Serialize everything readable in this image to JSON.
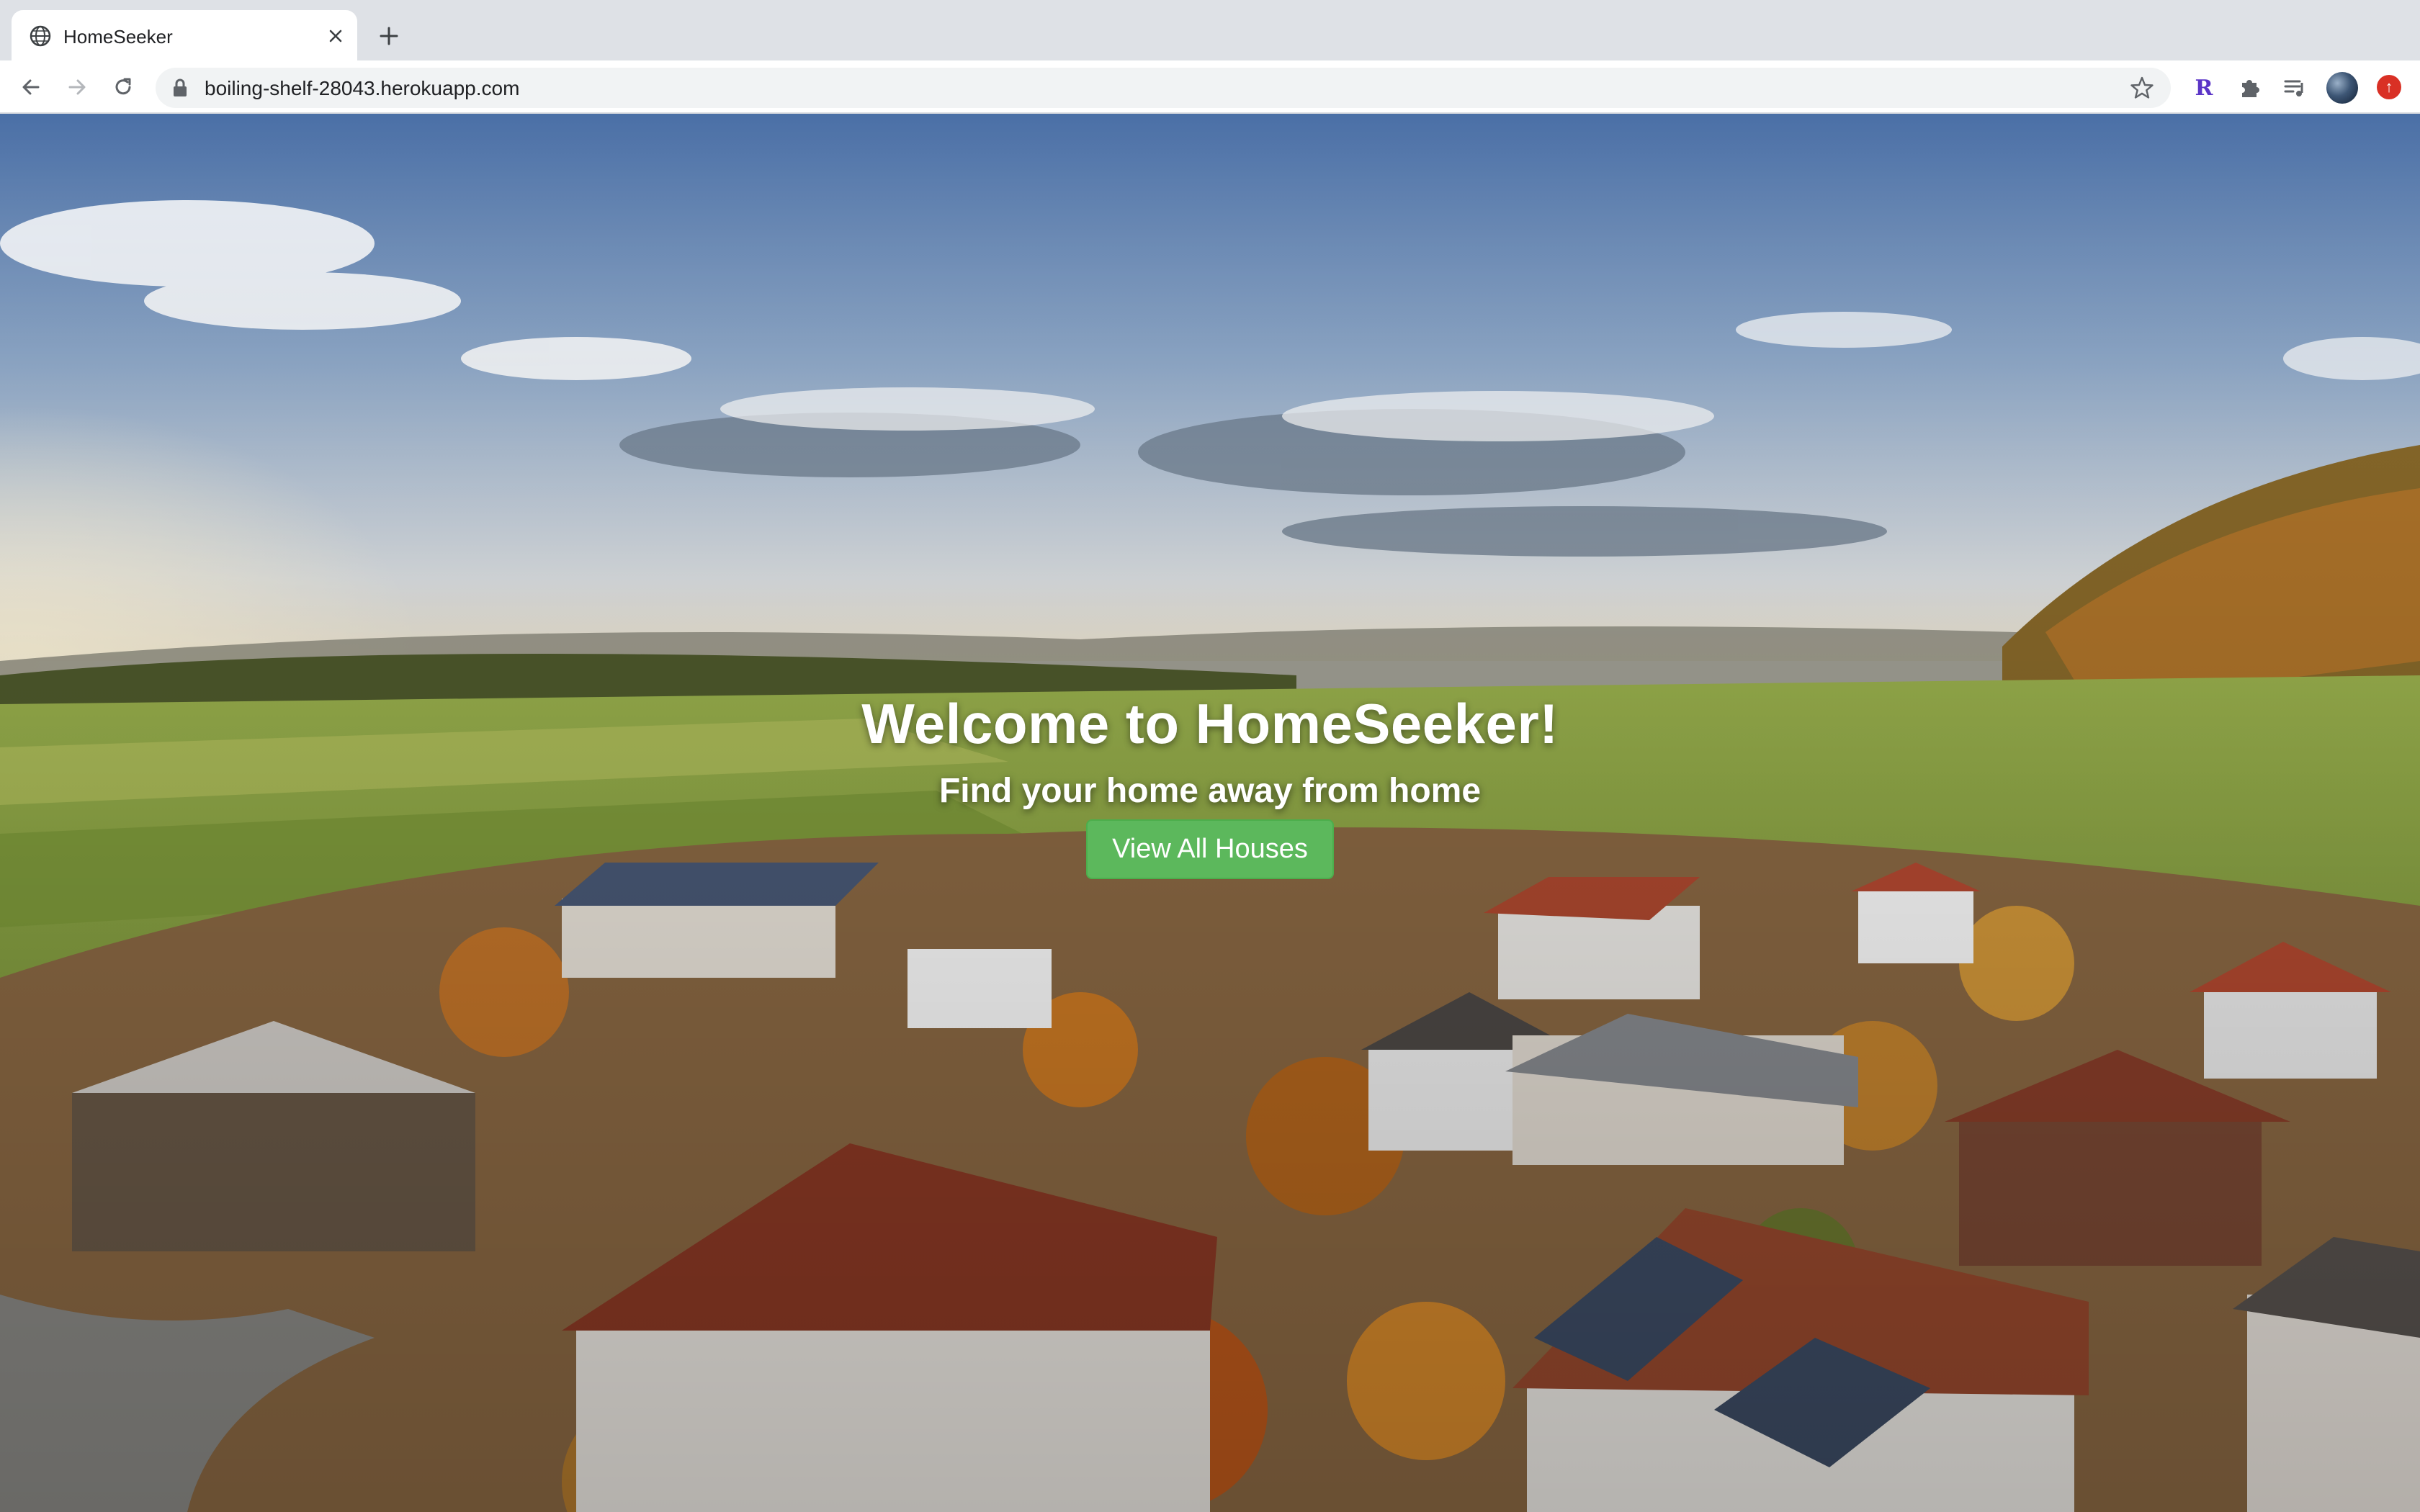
{
  "browser": {
    "tab": {
      "title": "HomeSeeker",
      "favicon": "globe-icon",
      "close_icon": "close-icon"
    },
    "new_tab_icon": "plus-icon",
    "nav": {
      "back_icon": "arrow-left-icon",
      "forward_icon": "arrow-right-icon",
      "reload_icon": "reload-icon"
    },
    "address_bar": {
      "url": "boiling-shelf-28043.herokuapp.com",
      "lock_icon": "lock-icon",
      "bookmark_icon": "star-icon"
    },
    "extensions": [
      {
        "name": "r-extension-icon",
        "label": "R",
        "color": "#5b35c7"
      },
      {
        "name": "puzzle-extensions-icon"
      },
      {
        "name": "media-queue-icon"
      }
    ],
    "profile": "avatar",
    "update_badge": {
      "label": "↑",
      "color": "#d93025"
    }
  },
  "hero": {
    "title": "Welcome to HomeSeeker!",
    "subtitle": "Find your home away from home",
    "button_label": "View All Houses",
    "button_color": "#5cb85c",
    "background": "aerial photo of an autumn village with farmland and blue sky"
  }
}
